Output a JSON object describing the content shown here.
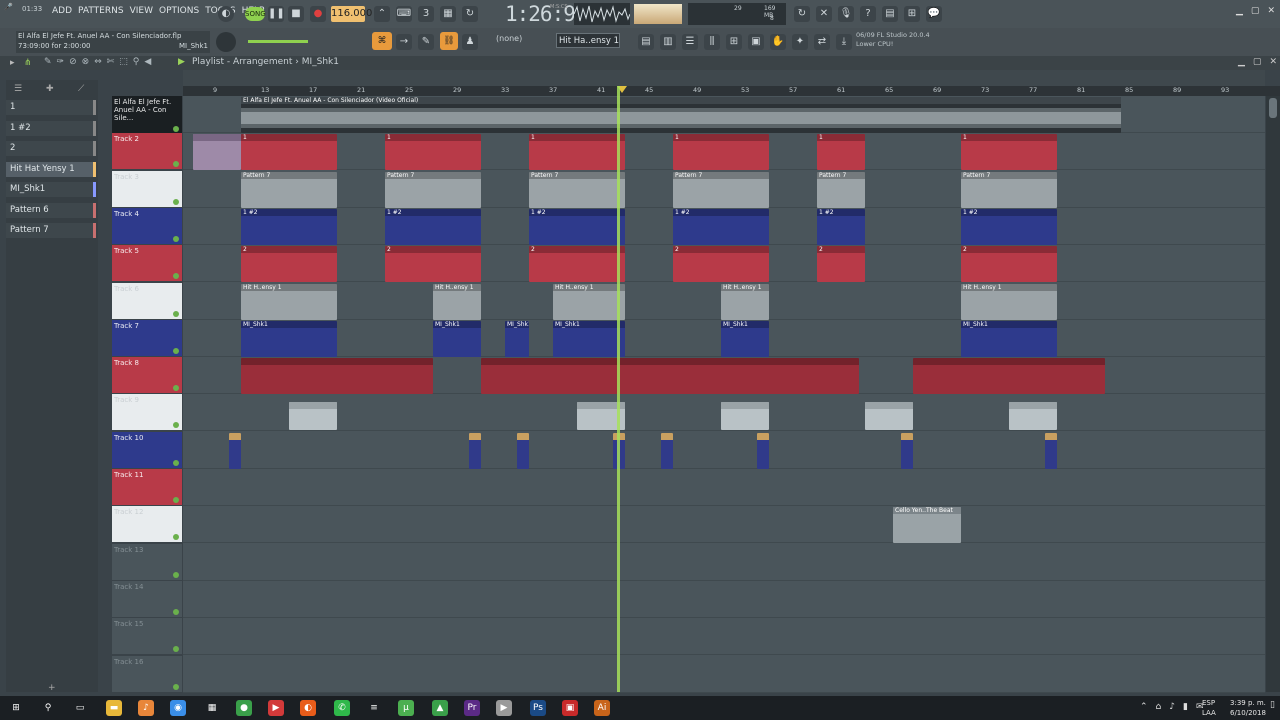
{
  "topbar": {
    "time_small": "01:33",
    "menu": [
      "ADD",
      "PATTERNS",
      "VIEW",
      "OPTIONS",
      "TOOLS",
      "HELP"
    ],
    "song_label": "SONG",
    "tempo": "116.000",
    "clock": "1:26:93",
    "clock_unit": "M:S:CS",
    "mem": "169 MB",
    "voices": "29",
    "polyphony": "8"
  },
  "bar2": {
    "project_name": "El Alfa El Jefe Ft. Anuel AA - Con Silenciador.flp",
    "project_time": "73:09:00 for 2:00:00",
    "selected_pattern": "MI_Shk1",
    "none_label": "(none)",
    "pattern_selector": "Hit Ha..ensy 1",
    "cpu_line1": "06/09  FL Studio 20.0.4",
    "cpu_line2": "Lower CPU!"
  },
  "playlist": {
    "title": "Playlist - Arrangement",
    "pattern": "MI_Shk1"
  },
  "picker": [
    "1",
    "1 #2",
    "2",
    "Hit Hat Yensy 1",
    "MI_Shk1",
    "Pattern 6",
    "Pattern 7"
  ],
  "ruler": [
    "9",
    "13",
    "17",
    "21",
    "25",
    "29",
    "33",
    "37",
    "41",
    "45",
    "49",
    "53",
    "57",
    "61",
    "65",
    "69",
    "73",
    "77",
    "81",
    "85",
    "89",
    "93"
  ],
  "tracks": [
    {
      "name": "El Alfa El Jefe Ft. Anuel AA - Con Sile..."
    },
    {
      "name": "Track 2"
    },
    {
      "name": "Track 3"
    },
    {
      "name": "Track 4"
    },
    {
      "name": "Track 5"
    },
    {
      "name": "Track 6"
    },
    {
      "name": "Track 7"
    },
    {
      "name": "Track 8"
    },
    {
      "name": "Track 9"
    },
    {
      "name": "Track 10"
    },
    {
      "name": "Track 11"
    },
    {
      "name": "Track 12"
    },
    {
      "name": "Track 13"
    },
    {
      "name": "Track 14"
    },
    {
      "name": "Track 15"
    },
    {
      "name": "Track 16"
    }
  ],
  "audio_clip_title": "El Alfa El Jefe Ft. Anuel AA - Con Silenciador (Video Oficial)",
  "cello_clip": "Cello Yen..The Beat",
  "clip_labels": {
    "p1": "1",
    "p7": "Pattern 7",
    "p1b": "1 #2",
    "p2": "2",
    "hh": "Hit H..ensy 1",
    "mi": "MI_Shk1"
  },
  "colors": {
    "red": "#b83a48",
    "blue": "#2e3a8c",
    "white": "#e8ecee",
    "accent": "#a6e05a"
  },
  "taskbar": {
    "lang1": "ESP",
    "lang2": "LAA",
    "time": "3:39 p. m.",
    "date": "6/10/2018"
  }
}
